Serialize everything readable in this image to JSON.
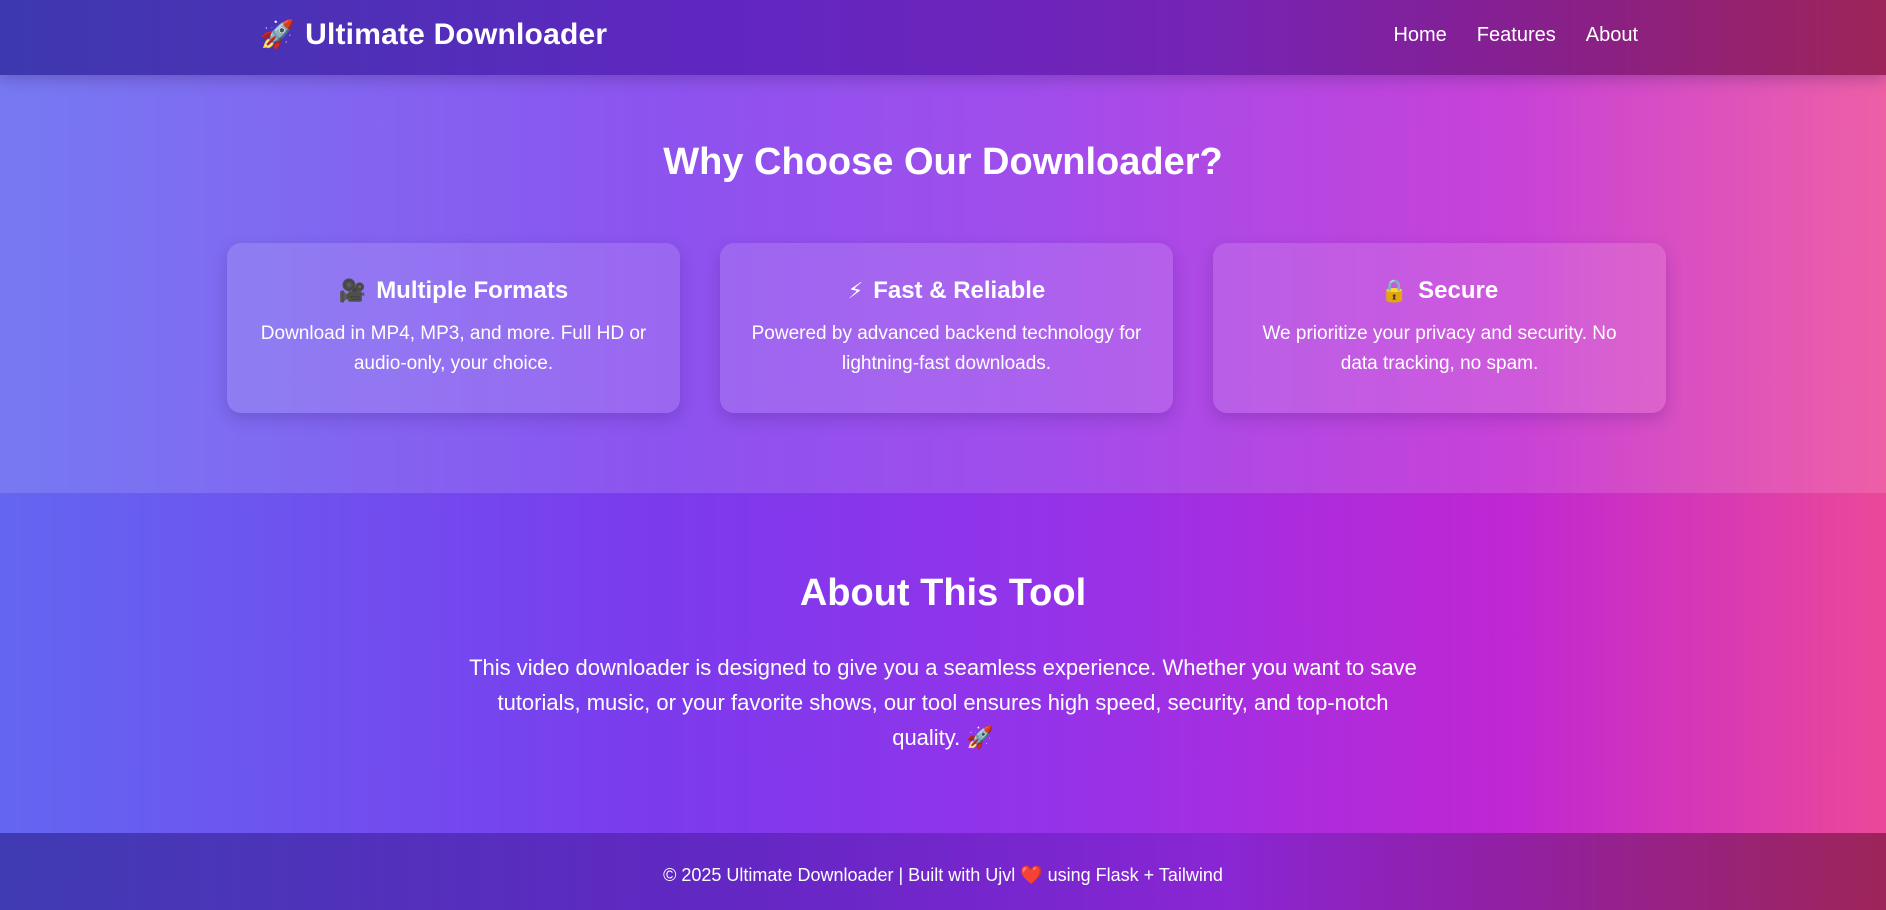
{
  "navbar": {
    "brand_icon": "🚀",
    "brand_icon_name": "rocket-icon",
    "brand_title": "Ultimate Downloader",
    "links": [
      "Home",
      "Features",
      "About"
    ]
  },
  "features": {
    "title": "Why Choose Our Downloader?",
    "cards": [
      {
        "icon": "🎥",
        "icon_name": "movie-camera-icon",
        "title": "Multiple Formats",
        "description": "Download in MP4, MP3, and more. Full HD or audio-only, your choice."
      },
      {
        "icon": "⚡",
        "icon_name": "lightning-icon",
        "title": "Fast & Reliable",
        "description": "Powered by advanced backend technology for lightning-fast downloads."
      },
      {
        "icon": "🔒",
        "icon_name": "lock-icon",
        "title": "Secure",
        "description": "We prioritize your privacy and security. No data tracking, no spam."
      }
    ]
  },
  "about": {
    "title": "About This Tool",
    "text": "This video downloader is designed to give you a seamless experience. Whether you want to save tutorials, music, or your favorite shows, our tool ensures high speed, security, and top-notch quality. 🚀"
  },
  "footer": {
    "text": "© 2025 Ultimate Downloader | Built with Ujvl ❤️ using Flask + Tailwind"
  },
  "colors": {
    "gradient_start": "#6366f1",
    "gradient_mid": "#9333ea",
    "gradient_end": "#ec4899",
    "text": "#ffffff"
  }
}
